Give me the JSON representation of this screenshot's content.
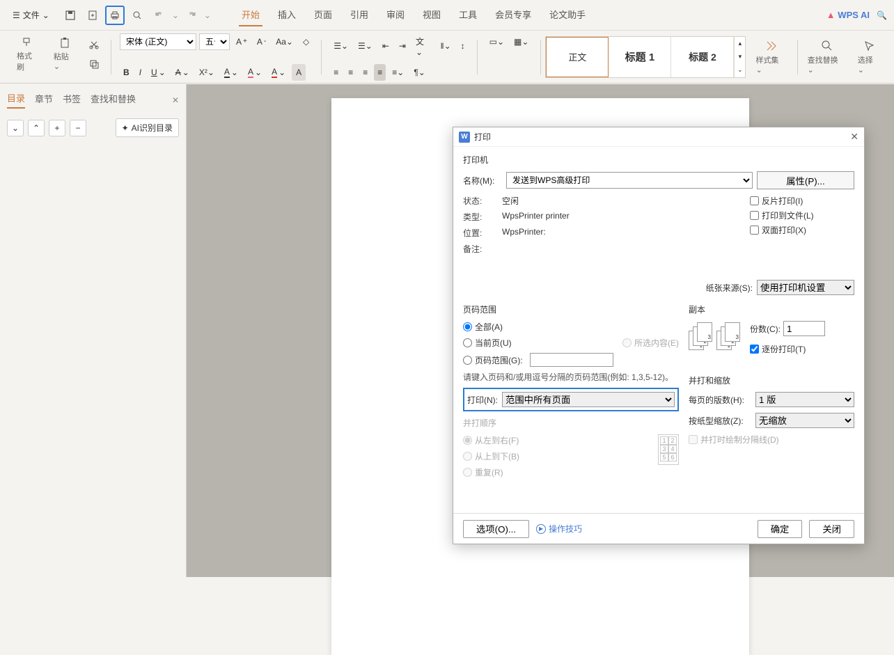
{
  "menu": {
    "file": "文件"
  },
  "tabs": {
    "start": "开始",
    "insert": "插入",
    "page": "页面",
    "ref": "引用",
    "review": "审阅",
    "view": "视图",
    "tool": "工具",
    "member": "会员专享",
    "thesis": "论文助手"
  },
  "wps_ai": "WPS AI",
  "ribbon": {
    "format_brush": "格式刷",
    "paste": "粘贴",
    "font_name": "宋体 (正文)",
    "font_size": "五号",
    "styles": {
      "normal": "正文",
      "h1": "标题 1",
      "h2": "标题 2"
    },
    "style_set": "样式集",
    "find_replace": "查找替换",
    "select": "选择"
  },
  "left_panel": {
    "tabs": {
      "toc": "目录",
      "chapter": "章节",
      "bookmark": "书签",
      "find": "查找和替换"
    },
    "ai_toc": "AI识别目录"
  },
  "dialog": {
    "title": "打印",
    "printer_section": "打印机",
    "name_label": "名称(M):",
    "name_value": "发送到WPS高级打印",
    "properties_btn": "属性(P)...",
    "status_label": "状态:",
    "status_value": "空闲",
    "type_label": "类型:",
    "type_value": "WpsPrinter printer",
    "location_label": "位置:",
    "location_value": "WpsPrinter:",
    "comment_label": "备注:",
    "reverse_print": "反片打印(I)",
    "print_to_file": "打印到文件(L)",
    "duplex": "双面打印(X)",
    "paper_source_label": "纸张来源(S):",
    "paper_source_value": "使用打印机设置",
    "page_range_section": "页码范围",
    "all": "全部(A)",
    "current": "当前页(U)",
    "selection": "所选内容(E)",
    "page_range": "页码范围(G):",
    "range_hint": "请键入页码和/或用逗号分隔的页码范围(例如: 1,3,5-12)。",
    "print_n_label": "打印(N):",
    "print_n_value": "范围中所有页面",
    "print_order_section": "并打顺序",
    "ltr": "从左到右(F)",
    "ttb": "从上到下(B)",
    "repeat": "重复(R)",
    "copies_section": "副本",
    "copies_label": "份数(C):",
    "copies_value": "1",
    "collate": "逐份打印(T)",
    "merge_zoom_section": "并打和缩放",
    "pages_per_sheet_label": "每页的版数(H):",
    "pages_per_sheet_value": "1 版",
    "scale_to_paper_label": "按纸型缩放(Z):",
    "scale_to_paper_value": "无缩放",
    "draw_lines": "并打时绘制分隔线(D)",
    "options_btn": "选项(O)...",
    "tips": "操作技巧",
    "ok": "确定",
    "cancel": "关闭"
  }
}
